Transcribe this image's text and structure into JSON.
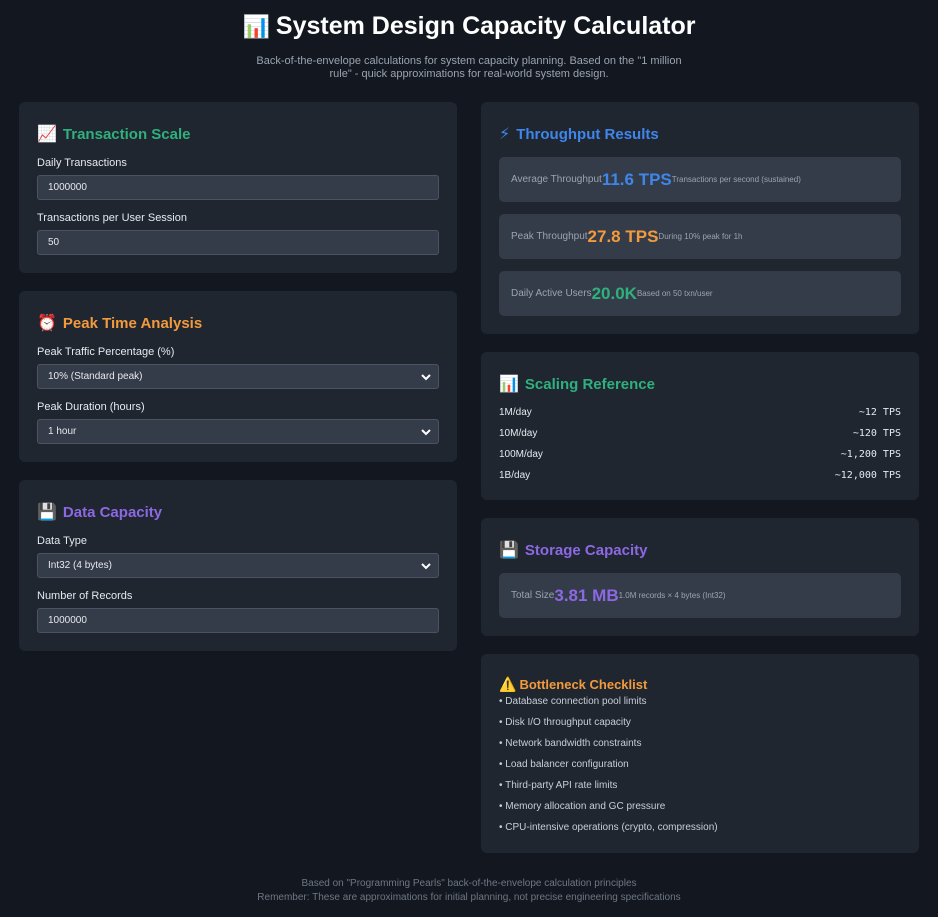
{
  "header": {
    "emoji": "📊",
    "title": "System Design Capacity Calculator",
    "subtitle": "Back-of-the-envelope calculations for system capacity planning. Based on the \"1 million rule\" - quick approximations for real-world system design."
  },
  "transaction_scale": {
    "emoji": "📈",
    "title": "Transaction Scale",
    "daily_label": "Daily Transactions",
    "daily_value": "1000000",
    "per_session_label": "Transactions per User Session",
    "per_session_value": "50"
  },
  "peak_time": {
    "emoji": "⏰",
    "title": "Peak Time Analysis",
    "peak_pct_label": "Peak Traffic Percentage (%)",
    "peak_pct_value": "10% (Standard peak)",
    "duration_label": "Peak Duration (hours)",
    "duration_value": "1 hour"
  },
  "data_capacity": {
    "emoji": "💾",
    "title": "Data Capacity",
    "type_label": "Data Type",
    "type_value": "Int32 (4 bytes)",
    "records_label": "Number of Records",
    "records_value": "1000000"
  },
  "throughput": {
    "emoji": "⚡",
    "title": "Throughput Results",
    "avg_label": "Average Throughput",
    "avg_value": "11.6 TPS",
    "avg_sub": "Transactions per second (sustained)",
    "peak_label": "Peak Throughput",
    "peak_value": "27.8 TPS",
    "peak_sub": "During 10% peak for 1h",
    "dau_label": "Daily Active Users",
    "dau_value": "20.0K",
    "dau_sub": "Based on 50 txn/user"
  },
  "scaling": {
    "emoji": "📊",
    "title": "Scaling Reference",
    "rows": [
      {
        "k": "1M/day",
        "v": "~12 TPS"
      },
      {
        "k": "10M/day",
        "v": "~120 TPS"
      },
      {
        "k": "100M/day",
        "v": "~1,200 TPS"
      },
      {
        "k": "1B/day",
        "v": "~12,000 TPS"
      }
    ]
  },
  "storage": {
    "emoji": "💾",
    "title": "Storage Capacity",
    "label": "Total Size",
    "value": "3.81 MB",
    "sub": "1.0M records × 4 bytes (Int32)"
  },
  "bottleneck": {
    "emoji": "⚠️",
    "title": "Bottleneck Checklist",
    "items": [
      "• Database connection pool limits",
      "• Disk I/O throughput capacity",
      "• Network bandwidth constraints",
      "• Load balancer configuration",
      "• Third-party API rate limits",
      "• Memory allocation and GC pressure",
      "• CPU-intensive operations (crypto, compression)"
    ]
  },
  "footer": {
    "line1": "Based on \"Programming Pearls\" back-of-the-envelope calculation principles",
    "line2": "Remember: These are approximations for initial planning, not precise engineering specifications"
  },
  "colors": {
    "background": "#131820",
    "card": "#1f2630",
    "green": "#2fb07c",
    "orange": "#f39a3d",
    "purple": "#8d68e3",
    "blue": "#3f86ea"
  }
}
